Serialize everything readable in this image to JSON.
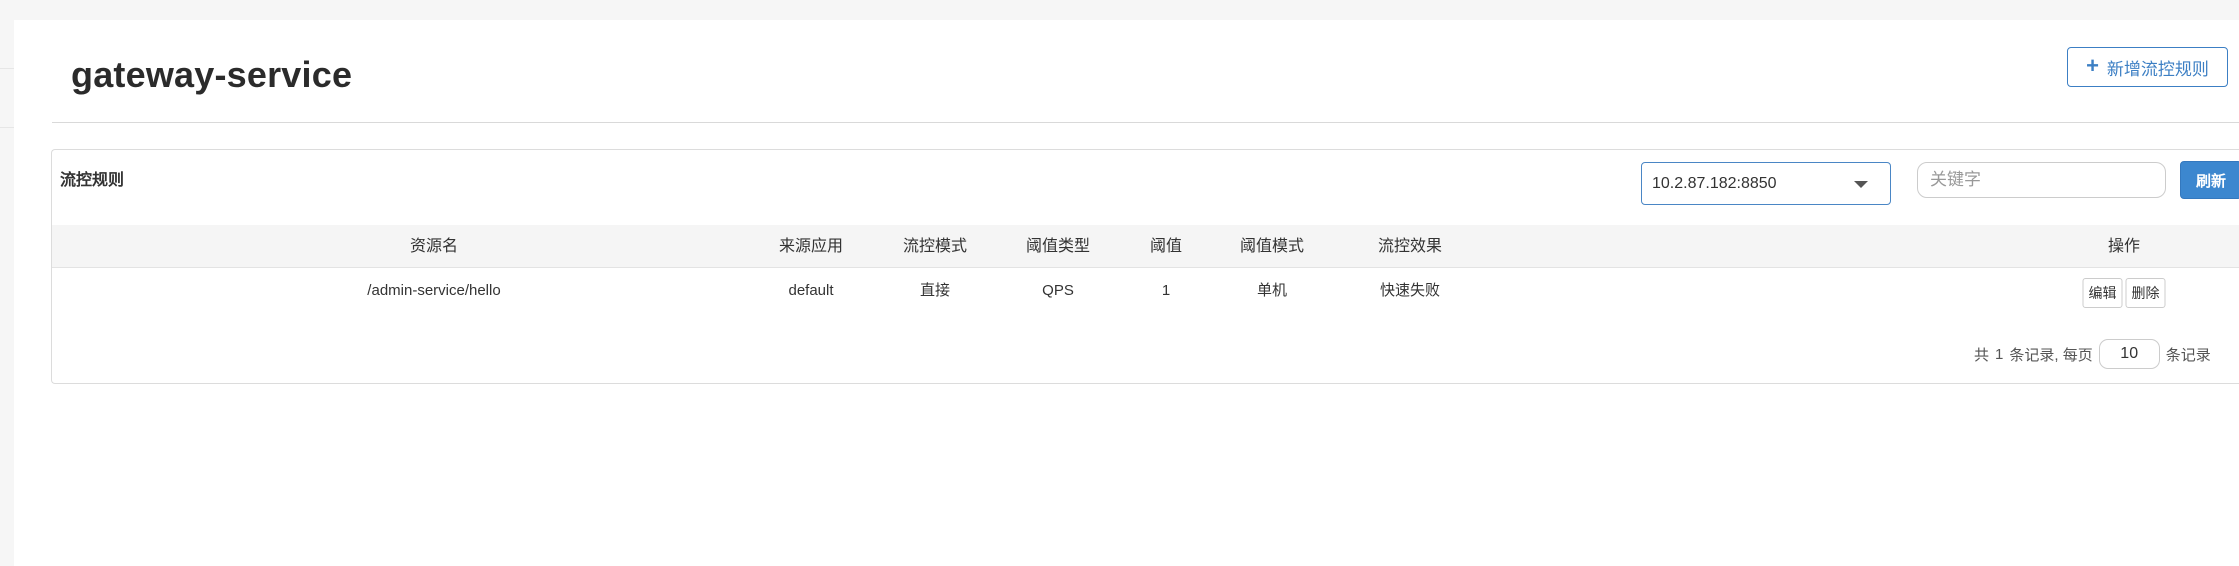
{
  "header": {
    "title": "gateway-service",
    "add_button_label": "新增流控规则",
    "add_button_icon": "plus-icon"
  },
  "panel": {
    "heading": "流控规则",
    "machine_select": {
      "value": "10.2.87.182:8850"
    },
    "search": {
      "placeholder": "关键字",
      "value": ""
    },
    "refresh_label": "刷新"
  },
  "table": {
    "columns": [
      "资源名",
      "来源应用",
      "流控模式",
      "阈值类型",
      "阈值",
      "阈值模式",
      "流控效果",
      "操作"
    ],
    "rows": [
      {
        "resource": "/admin-service/hello",
        "origin": "default",
        "mode": "直接",
        "threshold_type": "QPS",
        "threshold": "1",
        "threshold_mode": "单机",
        "effect": "快速失败",
        "edit_label": "编辑",
        "delete_label": "删除"
      }
    ]
  },
  "pagination": {
    "prefix": "共",
    "total": "1",
    "middle": "条记录, 每页",
    "page_size": "10",
    "suffix": "条记录"
  },
  "colors": {
    "accent": "#3c87cf",
    "outline_blue": "#3c7fc4"
  }
}
